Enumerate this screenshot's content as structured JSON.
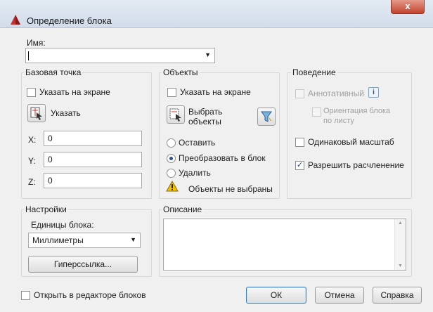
{
  "window": {
    "title": "Определение блока",
    "close": "x"
  },
  "name": {
    "label": "Имя:",
    "value": ""
  },
  "base_point": {
    "title": "Базовая точка",
    "specify_on_screen": "Указать на экране",
    "pick_button": "Указать",
    "x_label": "X:",
    "x_value": "0",
    "y_label": "Y:",
    "y_value": "0",
    "z_label": "Z:",
    "z_value": "0"
  },
  "objects": {
    "title": "Объекты",
    "specify_on_screen": "Указать на экране",
    "select_button_line1": "Выбрать",
    "select_button_line2": "объекты",
    "radio_retain": "Оставить",
    "radio_convert": "Преобразовать в блок",
    "radio_delete": "Удалить",
    "status": "Объекты не выбраны"
  },
  "behavior": {
    "title": "Поведение",
    "annotative": "Аннотативный",
    "info": "i",
    "orientation_line1": "Ориентация блока",
    "orientation_line2": "по листу",
    "uniform_scale": "Одинаковый масштаб",
    "allow_explode": "Разрешить расчленение"
  },
  "settings": {
    "title": "Настройки",
    "units_label": "Единицы блока:",
    "units_value": "Миллиметры",
    "hyperlink_button": "Гиперссылка..."
  },
  "description": {
    "title": "Описание"
  },
  "footer": {
    "open_in_editor": "Открыть в редакторе блоков",
    "ok": "ОК",
    "cancel": "Отмена",
    "help": "Справка"
  },
  "colors": {
    "accent": "#3c7fb1",
    "close": "#c2432b",
    "warning": "#f2c200"
  }
}
